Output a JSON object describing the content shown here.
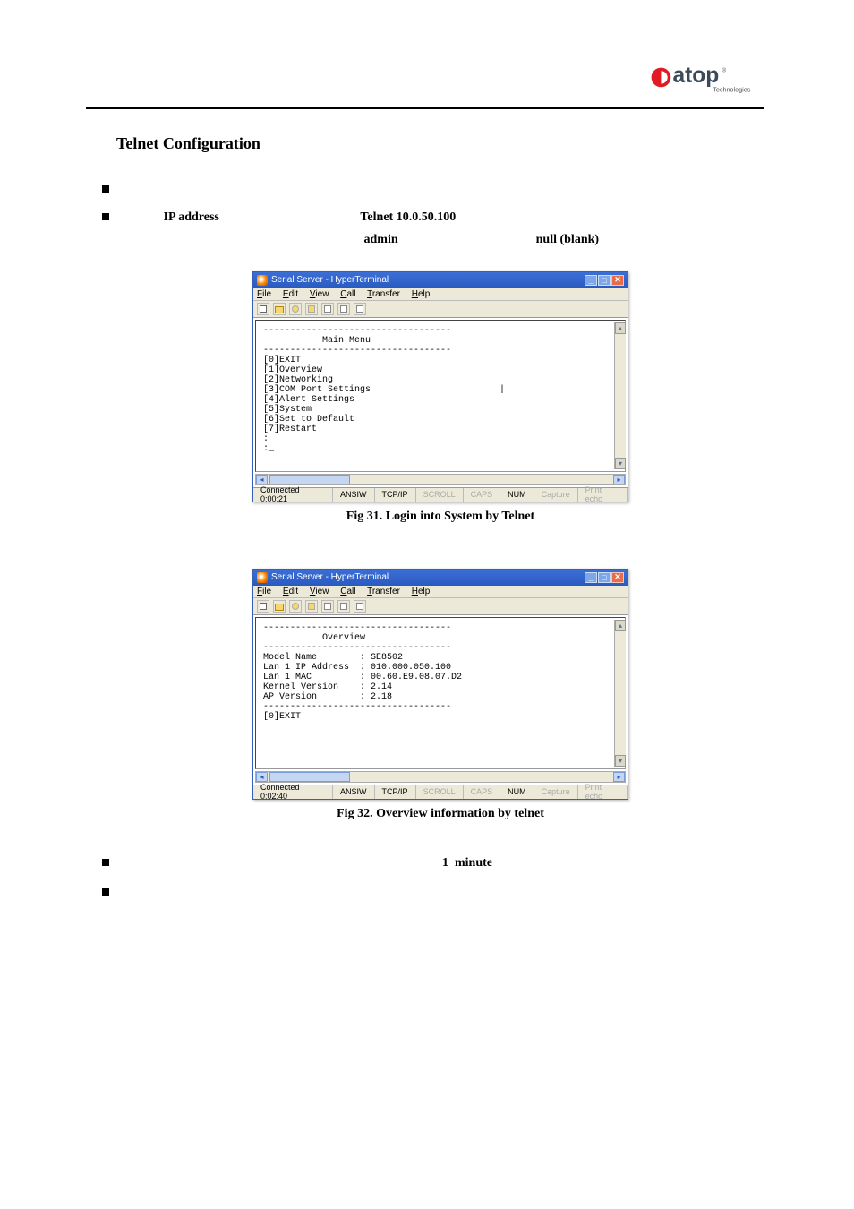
{
  "logo": {
    "brand": "atop",
    "sub": "Technologies"
  },
  "section_title": "Telnet Configuration",
  "bullets": {
    "ip_label": "IP address",
    "telnet_label": "Telnet 10.0.50.100",
    "username": "admin",
    "password_label": "null (blank)"
  },
  "fig31": {
    "window_title": "Serial Server - HyperTerminal",
    "menus": [
      "File",
      "Edit",
      "View",
      "Call",
      "Transfer",
      "Help"
    ],
    "terminal_lines": [
      "-----------------------------------",
      "           Main Menu",
      "-----------------------------------",
      "[0]EXIT",
      "[1]Overview",
      "[2]Networking",
      "[3]COM Port Settings",
      "[4]Alert Settings",
      "[5]System",
      "[6]Set to Default",
      "[7]Restart",
      ":",
      ":_"
    ],
    "status": {
      "connected": "Connected 0:00:21",
      "term": "ANSIW",
      "proto": "TCP/IP",
      "scroll": "SCROLL",
      "caps": "CAPS",
      "num": "NUM",
      "capture": "Capture",
      "print": "Print echo"
    },
    "caption": "Fig 31. Login into System by Telnet"
  },
  "fig32": {
    "window_title": "Serial Server - HyperTerminal",
    "menus": [
      "File",
      "Edit",
      "View",
      "Call",
      "Transfer",
      "Help"
    ],
    "terminal_lines": [
      "-----------------------------------",
      "           Overview",
      "-----------------------------------",
      "Model Name        : SE8502",
      "Lan 1 IP Address  : 010.000.050.100",
      "Lan 1 MAC         : 00.60.E9.08.07.D2",
      "Kernel Version    : 2.14",
      "AP Version        : 2.18",
      "-----------------------------------",
      "[0]EXIT"
    ],
    "status": {
      "connected": "Connected 0:02:40",
      "term": "ANSIW",
      "proto": "TCP/IP",
      "scroll": "SCROLL",
      "caps": "CAPS",
      "num": "NUM",
      "capture": "Capture",
      "print": "Print echo"
    },
    "caption": "Fig 32. Overview information by telnet"
  },
  "notes": {
    "minute": "1  minute"
  }
}
